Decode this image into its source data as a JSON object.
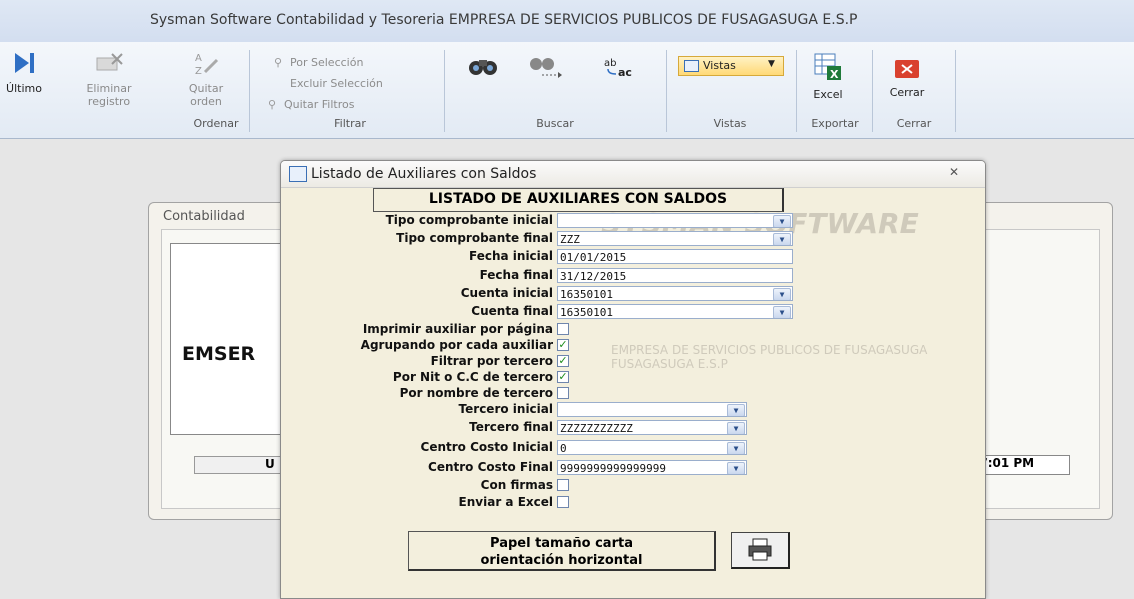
{
  "window_title": "Sysman Software Contabilidad y Tesoreria EMPRESA DE SERVICIOS PUBLICOS DE FUSAGASUGA E.S.P",
  "ribbon": {
    "ultimo": "Último",
    "eliminar_line1": "Eliminar",
    "eliminar_line2": "registro",
    "quitar_orden_line1": "Quitar",
    "quitar_orden_line2": "orden",
    "por_seleccion": "Por Selección",
    "excluir_seleccion": "Excluir Selección",
    "quitar_filtros": "Quitar Filtros",
    "vistas": "Vistas",
    "excel": "Excel",
    "cerrar": "Cerrar",
    "groups": {
      "ordenar": "Ordenar",
      "filtrar": "Filtrar",
      "buscar": "Buscar",
      "vistas": "Vistas",
      "exportar": "Exportar",
      "cerrar": "Cerrar"
    }
  },
  "background_form": {
    "title": "Contabilidad",
    "company_short": "EMSER",
    "user_prefix": "U",
    "time": "17:01 PM",
    "watermark_brand": "SYSMAN SOFTWARE",
    "watermark_company": "EMPRESA DE SERVICIOS PUBLICOS DE FUSAGASUGA",
    "watermark_company2": "FUSAGASUGA E.S.P"
  },
  "dialog": {
    "title": "Listado de Auxiliares con Saldos",
    "header": "LISTADO DE AUXILIARES CON SALDOS",
    "fields": {
      "tipo_inicial": {
        "label": "Tipo comprobante inicial",
        "value": ""
      },
      "tipo_final": {
        "label": "Tipo comprobante final",
        "value": "ZZZ"
      },
      "fecha_inicial": {
        "label": "Fecha inicial",
        "value": "01/01/2015"
      },
      "fecha_final": {
        "label": "Fecha final",
        "value": "31/12/2015"
      },
      "cuenta_inicial": {
        "label": "Cuenta inicial",
        "value": "16350101"
      },
      "cuenta_final": {
        "label": "Cuenta final",
        "value": "16350101"
      },
      "tercero_inicial": {
        "label": "Tercero inicial",
        "value": ""
      },
      "tercero_final": {
        "label": "Tercero final",
        "value": "ZZZZZZZZZZZ"
      },
      "cc_inicial": {
        "label": "Centro Costo Inicial",
        "value": "0"
      },
      "cc_final": {
        "label": "Centro Costo Final",
        "value": "9999999999999999"
      }
    },
    "checks": {
      "imprimir_pagina": {
        "label": "Imprimir auxiliar por página",
        "checked": false
      },
      "agrupando": {
        "label": "Agrupando por cada auxiliar",
        "checked": true
      },
      "filtrar_tercero": {
        "label": "Filtrar por tercero",
        "checked": true
      },
      "por_nit": {
        "label": "Por Nit o C.C de tercero",
        "checked": true
      },
      "por_nombre": {
        "label": "Por nombre de tercero",
        "checked": false
      },
      "con_firmas": {
        "label": "Con firmas",
        "checked": false
      },
      "enviar_excel": {
        "label": "Enviar a Excel",
        "checked": false
      }
    },
    "paper_line1": "Papel tamaño carta",
    "paper_line2": "orientación horizontal"
  }
}
